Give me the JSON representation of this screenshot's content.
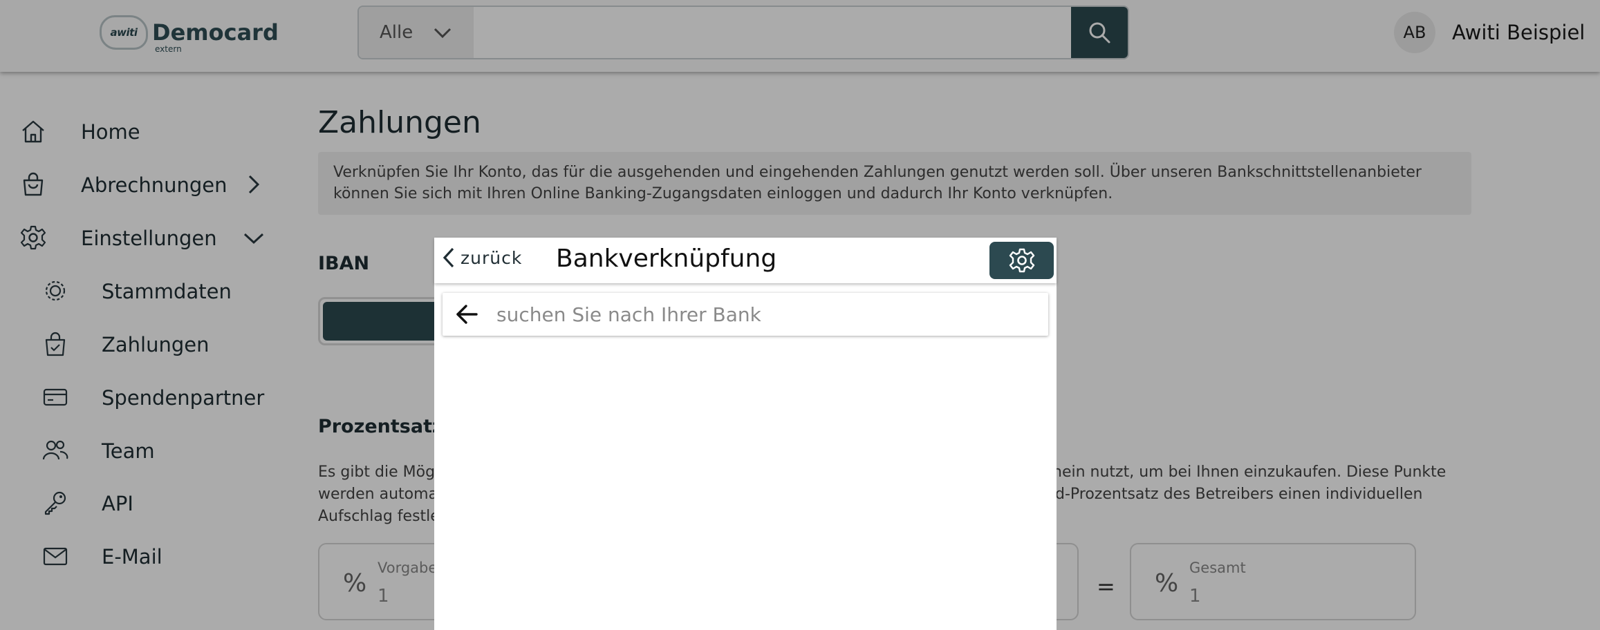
{
  "header": {
    "logo_mark": "awiti",
    "logo_name": "Democard",
    "logo_sub": "extern",
    "search": {
      "category": "Alle",
      "value": "",
      "placeholder": ""
    },
    "user": {
      "initials": "AB",
      "name": "Awiti Beispiel"
    }
  },
  "sidebar": {
    "items": [
      {
        "label": "Home",
        "icon": "home-icon"
      },
      {
        "label": "Abrechnungen",
        "icon": "bag-icon",
        "expand": "chevron-right-icon"
      },
      {
        "label": "Einstellungen",
        "icon": "gear-icon",
        "expand": "chevron-down-icon"
      }
    ],
    "subitems": [
      {
        "label": "Stammdaten",
        "icon": "cog-icon"
      },
      {
        "label": "Zahlungen",
        "icon": "bag-check-icon"
      },
      {
        "label": "Spendenpartner",
        "icon": "card-icon"
      },
      {
        "label": "Team",
        "icon": "team-icon"
      },
      {
        "label": "API",
        "icon": "key-icon"
      },
      {
        "label": "E-Mail",
        "icon": "mail-icon"
      }
    ]
  },
  "main": {
    "title": "Zahlungen",
    "info": "Verknüpfen Sie Ihr Konto, das für die ausgehenden und eingehenden Zahlungen genutzt werden soll. Über unseren Bankschnittstellenanbieter können Sie sich mit Ihren Online Banking-Zugangsdaten einloggen und dadurch Ihr Konto verknüpfen.",
    "iban_label": "IBAN",
    "percent_label": "Prozentsatz",
    "percent_text_line1_left": "Es gibt die Mög",
    "percent_text_line1_right": "hein nutzt, um bei Ihnen einzukaufen. Diese Punkte",
    "percent_text_line2_left": "werden automa",
    "percent_text_line2_right": "d-Prozentsatz des Betreibers einen individuellen",
    "percent_text_line3_left": "Aufschlag festle",
    "fields": {
      "default_label": "Vorgabe",
      "default_value": "1",
      "total_label": "Gesamt",
      "total_value": "1",
      "equals": "="
    }
  },
  "modal": {
    "back_label": "zurück",
    "title": "Bankverknüpfung",
    "search_placeholder": "suchen Sie nach Ihrer Bank",
    "search_value": ""
  },
  "colors": {
    "primary": "#2c4950",
    "overlay": "rgba(0,0,0,0.33)",
    "text": "#1f2d33"
  }
}
